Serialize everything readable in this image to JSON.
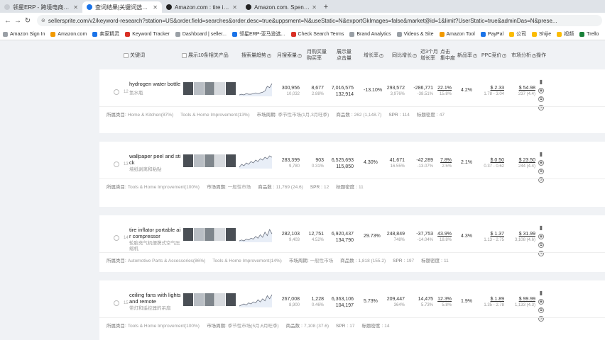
{
  "browser": {
    "tabs": [
      {
        "title": "领星ERP - 跨境电商管理系统",
        "active": false
      },
      {
        "title": "查词结果|关键词选品|卖家精灵",
        "active": true
      },
      {
        "title": "Amazon.com : tire inflator po",
        "active": false
      },
      {
        "title": "Amazon.com. Spend less. Sm",
        "active": false
      }
    ],
    "url": "sellersprite.com/v2/keyword-research?station=US&order.field=searches&order.desc=true&uppsment=N&useStatic=N&exportGkImages=false&market@id=1&limit?UserStatic=true&adminDas=N&prese...",
    "bookmarks": [
      "Amazon Sign In",
      "Amazon.com",
      "卖家精灵",
      "Keyword Tracker",
      "Dashboard | seller...",
      "领星ERP-亚马逊选...",
      "Check Search Terms",
      "Brand Analytics",
      "Videos & Site",
      "Amazon Tool",
      "PayPal",
      "公司",
      "Shijie",
      "视频",
      "Trello"
    ]
  },
  "table_header": {
    "keyword": "关键词",
    "show_products": "展示10条相关产品",
    "search_trend": "搜索量趋势",
    "monthly_search": "月搜索量",
    "monthly_purchase": "月购买量",
    "purchase_rate": "购买率",
    "display_clicks_1": "展示量",
    "display_clicks_2": "点击量",
    "growth_rate": "增长率",
    "yoy_growth": "同比增长",
    "three_month_1": "近3个月",
    "three_month_2": "增长率",
    "click_conc_1": "点击",
    "click_conc_2": "集中度",
    "new_ratio": "新品率",
    "ppc": "PPC竞价",
    "market_analysis": "市场分析",
    "ops": "操作"
  },
  "rows": [
    {
      "rank": "12",
      "keyword": "hydrogen water bottle",
      "keyword_cn": "氢水瓶",
      "monthly_search": "300,956",
      "monthly_search_sub": "10,032",
      "purchases": "8,677",
      "purchase_rate": "2.88%",
      "impressions": "7,016,575",
      "clicks": "132,914",
      "growth": "-13.10%",
      "yoy": "293,572",
      "yoy_sub": "3,976%",
      "three_month": "-286,771",
      "three_month_sub": "-38.51%",
      "click_conc": "22.1%",
      "click_conc_sub": "15.8%",
      "new_ratio": "4.2%",
      "ppc": "$ 2.33",
      "ppc_range": "1.78 - 3.04",
      "market": "$ 54.98",
      "market_sub": "237 (4.4)",
      "meta": {
        "category_label": "所属类目:",
        "categories": [
          "Home & Kitchen(87%)",
          "Tools & Home Improvement(13%)"
        ],
        "cycle_label": "市场周期:",
        "cycle": "季节性市场(1月,3月旺季)",
        "product_count_label": "商品数",
        "product_count": "262 (1,148.7)",
        "spr_label": "SPR",
        "spr": "114",
        "title_density_label": "标题密度",
        "title_density": "47"
      },
      "trend": [
        3,
        4,
        3,
        5,
        4,
        4,
        5,
        6,
        5,
        6,
        7,
        9,
        16,
        14,
        20
      ]
    },
    {
      "rank": "13",
      "keyword": "wallpaper peel and stick",
      "keyword_cn": "墙纸剥离和粘贴",
      "monthly_search": "283,399",
      "monthly_search_sub": "9,780",
      "purchases": "903",
      "purchase_rate": "0.31%",
      "impressions": "6,525,693",
      "clicks": "115,850",
      "growth": "4.30%",
      "yoy": "41,671",
      "yoy_sub": "16.55%",
      "three_month": "-42,289",
      "three_month_sub": "-13.07%",
      "click_conc": "7.8%",
      "click_conc_sub": "2.5%",
      "new_ratio": "2.1%",
      "ppc": "$ 0.50",
      "ppc_range": "0.37 - 0.62",
      "market": "$ 23.50",
      "market_sub": "244 (4.4)",
      "meta": {
        "category_label": "所属类目:",
        "categories": [
          "Tools & Home Improvement(100%)"
        ],
        "cycle_label": "市场周期:",
        "cycle": "一般性市场",
        "product_count_label": "商品数",
        "product_count": "11,769 (24.6)",
        "spr_label": "SPR",
        "spr": "12",
        "title_density_label": "标题密度",
        "title_density": "11"
      },
      "trend": [
        4,
        6,
        5,
        7,
        6,
        8,
        7,
        9,
        8,
        10,
        9,
        11,
        10,
        12,
        11
      ]
    },
    {
      "rank": "14",
      "keyword": "tire inflator portable air compressor",
      "keyword_cn": "轮胎充气机便携式空气压缩机",
      "monthly_search": "282,103",
      "monthly_search_sub": "9,403",
      "purchases": "12,751",
      "purchase_rate": "4.52%",
      "impressions": "6,920,437",
      "clicks": "134,790",
      "growth": "29.73%",
      "yoy": "248,849",
      "yoy_sub": "748%",
      "three_month": "-37,753",
      "three_month_sub": "-14.04%",
      "click_conc": "43.9%",
      "click_conc_sub": "18.8%",
      "new_ratio": "4.3%",
      "ppc": "$ 1.37",
      "ppc_range": "1.13 - 2.75",
      "market": "$ 31.99",
      "market_sub": "3,108 (4.6)",
      "meta": {
        "category_label": "所属类目:",
        "categories": [
          "Automotive Parts & Accessories(86%)",
          "Tools & Home Improvement(14%)"
        ],
        "cycle_label": "市场周期:",
        "cycle": "一般性市场",
        "product_count_label": "商品数",
        "product_count": "1,818 (155.2)",
        "spr_label": "SPR",
        "spr": "197",
        "title_density_label": "标题密度",
        "title_density": "11"
      },
      "trend": [
        2,
        3,
        2,
        4,
        3,
        5,
        4,
        7,
        5,
        9,
        6,
        12,
        8,
        15,
        10
      ]
    },
    {
      "rank": "15",
      "keyword": "ceiling fans with lights and remote",
      "keyword_cn": "带灯和遥控器的吊扇",
      "monthly_search": "267,008",
      "monthly_search_sub": "8,900",
      "purchases": "1,228",
      "purchase_rate": "0.46%",
      "impressions": "6,363,106",
      "clicks": "104,197",
      "growth": "5.73%",
      "yoy": "209,447",
      "yoy_sub": "364%",
      "three_month": "14,475",
      "three_month_sub": "5.73%",
      "click_conc": "12.3%",
      "click_conc_sub": "5.8%",
      "new_ratio": "1.9%",
      "ppc": "$ 1.89",
      "ppc_range": "1.35 - 2.78",
      "market": "$ 99.99",
      "market_sub": "1,133 (4.3)",
      "meta": {
        "category_label": "所属类目:",
        "categories": [
          "Tools & Home Improvement(100%)"
        ],
        "cycle_label": "市场周期:",
        "cycle": "季节性市场(5月,6月旺季)",
        "product_count_label": "商品数",
        "product_count": "7,108 (37.6)",
        "spr_label": "SPR",
        "spr": "17",
        "title_density_label": "标题密度",
        "title_density": "14"
      },
      "trend": [
        3,
        4,
        5,
        4,
        6,
        5,
        7,
        6,
        9,
        7,
        10,
        8,
        13,
        10,
        14
      ]
    }
  ]
}
